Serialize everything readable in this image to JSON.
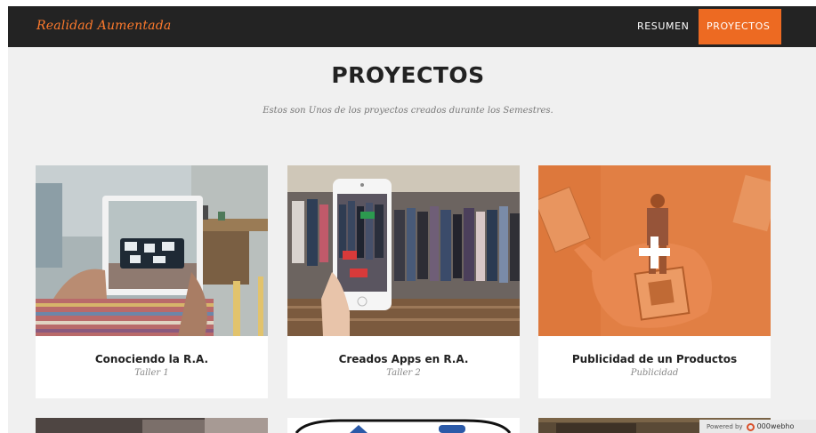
{
  "navbar": {
    "brand": "Realidad Aumentada",
    "links": [
      {
        "label": "RESUMEN"
      },
      {
        "label": "PROYECTOS",
        "active": true
      }
    ],
    "accent_color": "#ed6a22",
    "background_color": "#232323"
  },
  "section": {
    "title": "PROYECTOS",
    "subtitle": "Estos son Unos de los proyectos creados durante los Semestres."
  },
  "portfolio": [
    {
      "title": "Conociendo la R.A.",
      "category": "Taller 1",
      "image": "tablet-living-room-photo"
    },
    {
      "title": "Creados Apps en R.A.",
      "category": "Taller 2",
      "image": "phone-clothing-store-photo",
      "ar_labels": [
        "BUY 1 GET 1",
        "SALE 50% OFF"
      ]
    },
    {
      "title": "Publicidad de un Productos",
      "category": "Publicidad",
      "image": "ar-business-card-photo",
      "hovered": true,
      "hover_icon": "plus-icon"
    }
  ],
  "footer_badge": {
    "prefix": "Powered by",
    "host": "000webho"
  }
}
